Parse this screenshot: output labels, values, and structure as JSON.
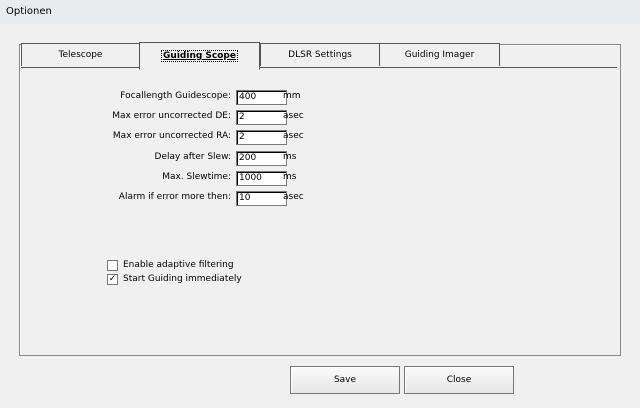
{
  "window": {
    "title": "Optionen"
  },
  "tabs": [
    {
      "label": "Telescope"
    },
    {
      "label": "Guiding Scope"
    },
    {
      "label": "DLSR Settings"
    },
    {
      "label": "Guiding Imager"
    }
  ],
  "fields": [
    {
      "label": "Focallength Guidescope:",
      "value": "400",
      "unit": "mm"
    },
    {
      "label": "Max error uncorrected DE:",
      "value": "2",
      "unit": "asec"
    },
    {
      "label": "Max error uncorrected RA:",
      "value": "2",
      "unit": "asec"
    },
    {
      "label": "Delay after Slew:",
      "value": "200",
      "unit": "ms"
    },
    {
      "label": "Max. Slewtime:",
      "value": "1000",
      "unit": "ms"
    },
    {
      "label": "Alarm if error more then:",
      "value": "10",
      "unit": "asec"
    }
  ],
  "checkboxes": [
    {
      "label": "Enable adaptive filtering",
      "checked": "false",
      "mark": ""
    },
    {
      "label": "Start Guiding immediately",
      "checked": "true",
      "mark": "✓"
    }
  ],
  "buttons": {
    "save": "Save",
    "close": "Close"
  }
}
